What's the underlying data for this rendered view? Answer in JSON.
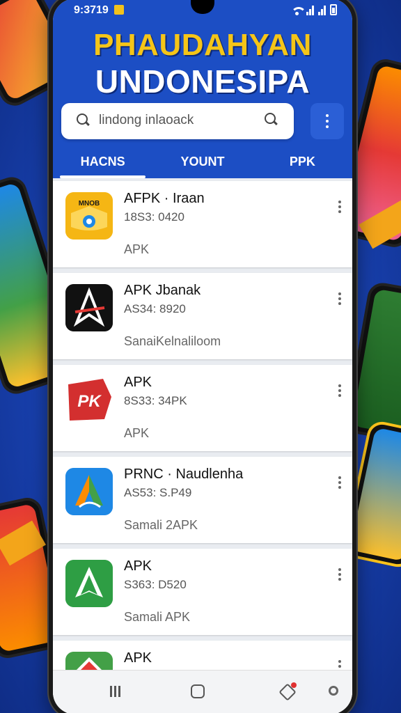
{
  "status_bar": {
    "time": "9:3719"
  },
  "header": {
    "title_line1": "PHAUDAHYAN",
    "title_line2": "UNDONESIPA",
    "bg_color": "#1c4ec4",
    "title_accent": "#f5c518"
  },
  "search": {
    "value": "lindong inlaoack",
    "lead_icon": "search-icon",
    "trail_icon": "search-icon"
  },
  "more_menu": {
    "icon": "more-vertical-icon"
  },
  "tabs": [
    {
      "label": "HACNS",
      "active": true
    },
    {
      "label": "YOUNT",
      "active": false
    },
    {
      "label": "PPK",
      "active": false
    }
  ],
  "apps": [
    {
      "name": "AFPK · Iraan",
      "meta": "18S3: 0420",
      "sub": "APK",
      "icon": "eye-logo-icon",
      "icon_badge": "MNOB"
    },
    {
      "name": "APK Jbanak",
      "meta": "AS34: 8920",
      "sub": "SanaiKelnaliloom",
      "icon": "compass-logo-icon",
      "icon_badge": ""
    },
    {
      "name": "APK",
      "meta": "8S33: 34PK",
      "sub": "APK",
      "icon": "apk-shield-icon",
      "icon_badge": "PK"
    },
    {
      "name": "PRNC · Naudlenha",
      "meta": "AS53: S.P49",
      "sub": "Samali 2APK",
      "icon": "drive-logo-icon",
      "icon_badge": ""
    },
    {
      "name": "APK",
      "meta": "S363: D520",
      "sub": "Samali APK",
      "icon": "green-triangle-icon",
      "icon_badge": ""
    },
    {
      "name": "APK",
      "meta": "",
      "sub": "",
      "icon": "green-arrow-icon",
      "icon_badge": ""
    }
  ],
  "nav": {
    "recents": "recents-icon",
    "home": "home-icon",
    "back": "back-icon",
    "assistant": "assistant-icon"
  }
}
